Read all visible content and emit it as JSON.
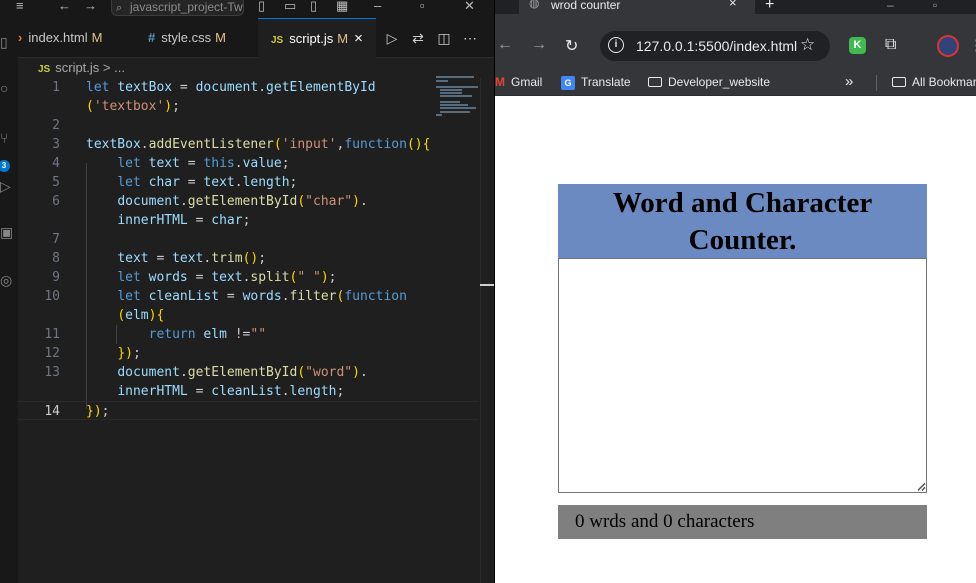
{
  "vscode": {
    "window_title": "javascript_project-Two",
    "tabs": [
      {
        "label": "index.html",
        "modified": "M"
      },
      {
        "label": "style.css",
        "modified": "M"
      },
      {
        "label": "script.js",
        "modified": "M",
        "close": "×"
      }
    ],
    "breadcrumb": {
      "file": "script.js",
      "sep": ">",
      "symbol": "..."
    },
    "source_control_badge": "3",
    "current_line": 14,
    "line_numbers": [
      "1",
      "",
      "2",
      "3",
      "4",
      "5",
      "6",
      "",
      "7",
      "8",
      "9",
      "10",
      "",
      "11",
      "12",
      "13",
      "",
      "14"
    ],
    "code_lines": [
      "let textBox = document.getElementById",
      "('textbox');",
      "",
      "textBox.addEventListener('input',function(){",
      "    let text = this.value;",
      "    let char = text.length;",
      "    document.getElementById(\"char\").",
      "    innerHTML = char;",
      "",
      "    text = text.trim();",
      "    let words = text.split(\" \");",
      "    let cleanList = words.filter(function",
      "    (elm){",
      "        return elm !=\"\"",
      "    });",
      "    document.getElementById(\"word\").",
      "    innerHTML = cleanList.length;",
      "});"
    ]
  },
  "browser": {
    "tab_title": "wrod counter",
    "tab_close": "×",
    "new_tab": "+",
    "url": "127.0.0.1:5500/index.html",
    "extension_k": "K",
    "bookmarks": [
      {
        "label": "Gmail",
        "icon": "gmail-icon"
      },
      {
        "label": "Translate",
        "icon": "translate-icon"
      },
      {
        "label": "Developer_website",
        "icon": "folder-icon"
      }
    ],
    "bookmarks_more": "»",
    "all_bookmarks": "All Bookmarks"
  },
  "page": {
    "title": "Word and Character Counter.",
    "textarea_value": "",
    "result": {
      "words": "0",
      "words_label": "wrds and",
      "chars": "0",
      "chars_label": "characters"
    }
  },
  "colors": {
    "header_bg": "#6a8ac1",
    "result_bg": "#7f7f7f",
    "vscode_bg": "#1f1f1f",
    "keyword": "#569cd6",
    "string": "#ce9178",
    "function": "#dcdcaa",
    "variable": "#9cdcfe"
  }
}
